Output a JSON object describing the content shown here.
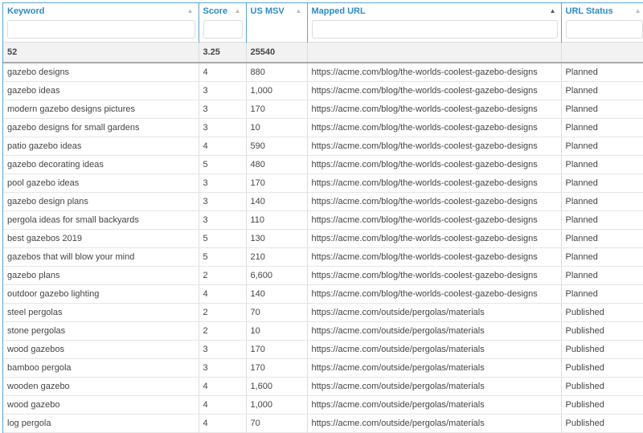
{
  "columns": [
    {
      "label": "Keyword",
      "sort": "inactive"
    },
    {
      "label": "Score",
      "sort": "inactive"
    },
    {
      "label": "US MSV",
      "sort": "inactive"
    },
    {
      "label": "Mapped URL",
      "sort": "active"
    },
    {
      "label": "URL Status",
      "sort": "inactive"
    }
  ],
  "summary": [
    "52",
    "3.25",
    "25540",
    "",
    ""
  ],
  "rows": [
    [
      "gazebo designs",
      "4",
      "880",
      "https://acme.com/blog/the-worlds-coolest-gazebo-designs",
      "Planned"
    ],
    [
      "gazebo ideas",
      "3",
      "1,000",
      "https://acme.com/blog/the-worlds-coolest-gazebo-designs",
      "Planned"
    ],
    [
      "modern gazebo designs pictures",
      "3",
      "170",
      "https://acme.com/blog/the-worlds-coolest-gazebo-designs",
      "Planned"
    ],
    [
      "gazebo designs for small gardens",
      "3",
      "10",
      "https://acme.com/blog/the-worlds-coolest-gazebo-designs",
      "Planned"
    ],
    [
      "patio gazebo ideas",
      "4",
      "590",
      "https://acme.com/blog/the-worlds-coolest-gazebo-designs",
      "Planned"
    ],
    [
      "gazebo decorating ideas",
      "5",
      "480",
      "https://acme.com/blog/the-worlds-coolest-gazebo-designs",
      "Planned"
    ],
    [
      "pool gazebo ideas",
      "3",
      "170",
      "https://acme.com/blog/the-worlds-coolest-gazebo-designs",
      "Planned"
    ],
    [
      "gazebo design plans",
      "3",
      "140",
      "https://acme.com/blog/the-worlds-coolest-gazebo-designs",
      "Planned"
    ],
    [
      "pergola ideas for small backyards",
      "3",
      "110",
      "https://acme.com/blog/the-worlds-coolest-gazebo-designs",
      "Planned"
    ],
    [
      "best gazebos 2019",
      "5",
      "130",
      "https://acme.com/blog/the-worlds-coolest-gazebo-designs",
      "Planned"
    ],
    [
      "gazebos that will blow your mind",
      "5",
      "210",
      "https://acme.com/blog/the-worlds-coolest-gazebo-designs",
      "Planned"
    ],
    [
      "gazebo plans",
      "2",
      "6,600",
      "https://acme.com/blog/the-worlds-coolest-gazebo-designs",
      "Planned"
    ],
    [
      "outdoor gazebo lighting",
      "4",
      "140",
      "https://acme.com/blog/the-worlds-coolest-gazebo-designs",
      "Planned"
    ],
    [
      "steel pergolas",
      "2",
      "70",
      "https://acme.com/outside/pergolas/materials",
      "Published"
    ],
    [
      "stone pergolas",
      "2",
      "10",
      "https://acme.com/outside/pergolas/materials",
      "Published"
    ],
    [
      "wood gazebos",
      "3",
      "170",
      "https://acme.com/outside/pergolas/materials",
      "Published"
    ],
    [
      "bamboo pergola",
      "3",
      "170",
      "https://acme.com/outside/pergolas/materials",
      "Published"
    ],
    [
      "wooden gazebo",
      "4",
      "1,600",
      "https://acme.com/outside/pergolas/materials",
      "Published"
    ],
    [
      "wood gazebo",
      "4",
      "1,000",
      "https://acme.com/outside/pergolas/materials",
      "Published"
    ],
    [
      "log pergola",
      "4",
      "70",
      "https://acme.com/outside/pergolas/materials",
      "Published"
    ]
  ]
}
